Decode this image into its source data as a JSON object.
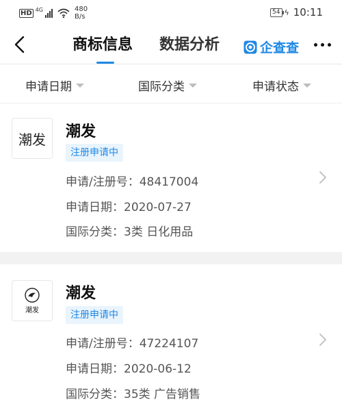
{
  "status_bar": {
    "hd": "HD",
    "network": "4G",
    "speed_value": "480",
    "speed_unit": "B/s",
    "battery": "54",
    "time": "10:11"
  },
  "header": {
    "tab_active": "商标信息",
    "tab_inactive": "数据分析",
    "brand": "企查查"
  },
  "filters": [
    {
      "label": "申请日期"
    },
    {
      "label": "国际分类"
    },
    {
      "label": "申请状态"
    }
  ],
  "records": [
    {
      "logo_text": "潮发",
      "name": "潮发",
      "status": "注册申请中",
      "reg_no": "申请/注册号：48417004",
      "apply_date": "申请日期：2020-07-27",
      "intl_class": "国际分类：3类 日化用品"
    },
    {
      "logo_text": "潮发",
      "name": "潮发",
      "status": "注册申请中",
      "reg_no": "申请/注册号：47224107",
      "apply_date": "申请日期：2020-06-12",
      "intl_class": "国际分类：35类 广告销售"
    }
  ],
  "colors": {
    "accent": "#1e88e5",
    "badge_bg": "#e9f4fd",
    "divider": "#f2f2f2"
  }
}
